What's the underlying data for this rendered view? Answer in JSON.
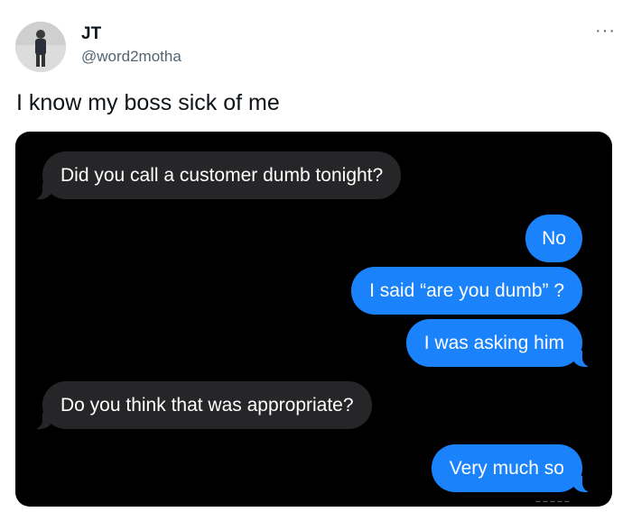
{
  "tweet": {
    "display_name": "JT",
    "handle": "@word2motha",
    "more_icon": "more-icon",
    "text": "I know my boss sick of me",
    "avatar_icon": "avatar"
  },
  "messages": [
    {
      "side": "in",
      "text": "Did you call a customer dumb tonight?"
    },
    {
      "side": "out",
      "text": "No"
    },
    {
      "side": "out",
      "text": "I said “are you dumb” ?"
    },
    {
      "side": "out",
      "text": "I was asking him"
    },
    {
      "side": "in",
      "text": "Do you think that was appropriate?"
    },
    {
      "side": "out",
      "text": "Very much so"
    }
  ],
  "colors": {
    "incoming_bubble": "#262628",
    "outgoing_bubble": "#1a82fb",
    "media_background": "#000000"
  }
}
